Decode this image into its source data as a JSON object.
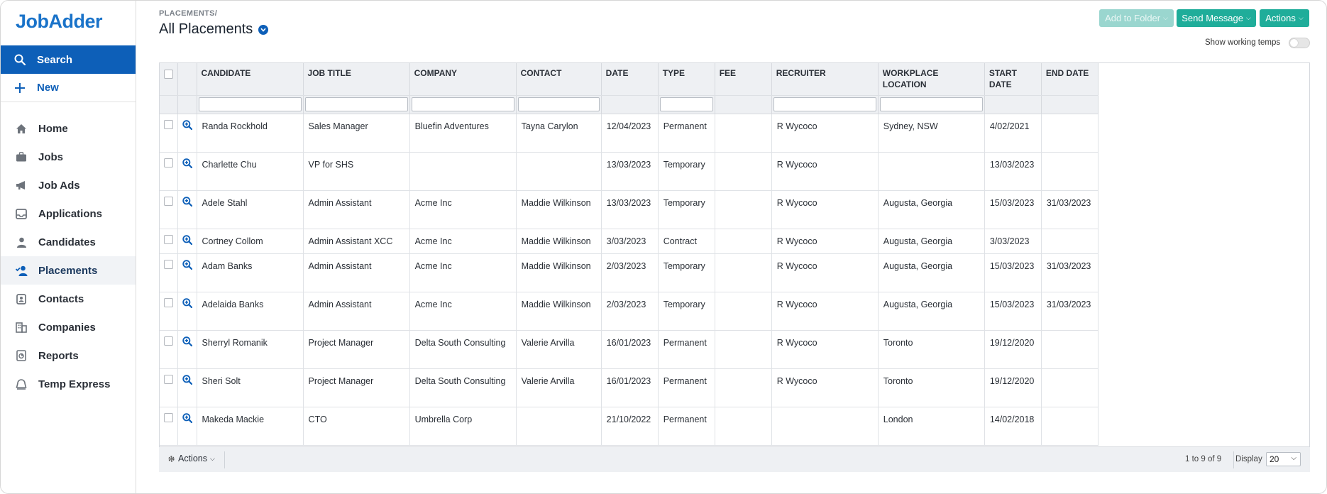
{
  "app": {
    "logo": "JobAdder"
  },
  "sidebar": {
    "search": "Search",
    "new": "New",
    "items": [
      {
        "label": "Home",
        "icon": "home-icon"
      },
      {
        "label": "Jobs",
        "icon": "briefcase-icon"
      },
      {
        "label": "Job Ads",
        "icon": "megaphone-icon"
      },
      {
        "label": "Applications",
        "icon": "inbox-icon"
      },
      {
        "label": "Candidates",
        "icon": "person-icon"
      },
      {
        "label": "Placements",
        "icon": "person-check-icon",
        "active": true
      },
      {
        "label": "Contacts",
        "icon": "contact-card-icon"
      },
      {
        "label": "Companies",
        "icon": "building-icon"
      },
      {
        "label": "Reports",
        "icon": "report-icon"
      },
      {
        "label": "Temp Express",
        "icon": "temp-express-icon"
      }
    ]
  },
  "header": {
    "breadcrumb": "PLACEMENTS/",
    "title": "All Placements",
    "add_to_folder": "Add to Folder",
    "send_message": "Send Message",
    "actions": "Actions",
    "show_working_temps": "Show working temps"
  },
  "table": {
    "columns": [
      "CANDIDATE",
      "JOB TITLE",
      "COMPANY",
      "CONTACT",
      "DATE",
      "TYPE",
      "FEE",
      "RECRUITER",
      "WORKPLACE LOCATION",
      "START DATE",
      "END DATE"
    ],
    "rows": [
      {
        "candidate": "Randa Rockhold",
        "job_title": "Sales Manager",
        "company": "Bluefin Adventures",
        "contact": "Tayna Carylon",
        "date": "12/04/2023",
        "type": "Permanent",
        "fee": "",
        "recruiter": "R Wycoco",
        "location": "Sydney, NSW",
        "start": "4/02/2021",
        "end": ""
      },
      {
        "candidate": "Charlette Chu",
        "job_title": "VP for SHS",
        "company": "",
        "contact": "",
        "date": "13/03/2023",
        "type": "Temporary",
        "fee": "",
        "recruiter": "R Wycoco",
        "location": "",
        "start": "13/03/2023",
        "end": ""
      },
      {
        "candidate": "Adele Stahl",
        "job_title": "Admin Assistant",
        "company": "Acme Inc",
        "contact": "Maddie Wilkinson",
        "date": "13/03/2023",
        "type": "Temporary",
        "fee": "",
        "recruiter": "R Wycoco",
        "location": "Augusta, Georgia",
        "start": "15/03/2023",
        "end": "31/03/2023"
      },
      {
        "candidate": "Cortney Collom",
        "job_title": "Admin Assistant XCC",
        "company": "Acme Inc",
        "contact": "Maddie Wilkinson",
        "date": "3/03/2023",
        "type": "Contract",
        "fee": "",
        "recruiter": "R Wycoco",
        "location": "Augusta, Georgia",
        "start": "3/03/2023",
        "end": ""
      },
      {
        "candidate": "Adam Banks",
        "job_title": "Admin Assistant",
        "company": "Acme Inc",
        "contact": "Maddie Wilkinson",
        "date": "2/03/2023",
        "type": "Temporary",
        "fee": "",
        "recruiter": "R Wycoco",
        "location": "Augusta, Georgia",
        "start": "15/03/2023",
        "end": "31/03/2023"
      },
      {
        "candidate": "Adelaida Banks",
        "job_title": "Admin Assistant",
        "company": "Acme Inc",
        "contact": "Maddie Wilkinson",
        "date": "2/03/2023",
        "type": "Temporary",
        "fee": "",
        "recruiter": "R Wycoco",
        "location": "Augusta, Georgia",
        "start": "15/03/2023",
        "end": "31/03/2023"
      },
      {
        "candidate": "Sherryl Romanik",
        "job_title": "Project Manager",
        "company": "Delta South Consulting",
        "contact": "Valerie Arvilla",
        "date": "16/01/2023",
        "type": "Permanent",
        "fee": "",
        "recruiter": "R Wycoco",
        "location": "Toronto",
        "start": "19/12/2020",
        "end": ""
      },
      {
        "candidate": "Sheri Solt",
        "job_title": "Project Manager",
        "company": "Delta South Consulting",
        "contact": "Valerie Arvilla",
        "date": "16/01/2023",
        "type": "Permanent",
        "fee": "",
        "recruiter": "R Wycoco",
        "location": "Toronto",
        "start": "19/12/2020",
        "end": ""
      },
      {
        "candidate": "Makeda Mackie",
        "job_title": "CTO",
        "company": "Umbrella Corp",
        "contact": "",
        "date": "21/10/2022",
        "type": "Permanent",
        "fee": "",
        "recruiter": "",
        "location": "London",
        "start": "14/02/2018",
        "end": ""
      }
    ]
  },
  "footer": {
    "actions": "Actions",
    "count": "1 to 9 of 9",
    "display_label": "Display",
    "display_value": "20"
  },
  "colors": {
    "brand": "#0d5fb8",
    "teal": "#1fad9a",
    "teal_disabled": "#9ad6cf"
  }
}
